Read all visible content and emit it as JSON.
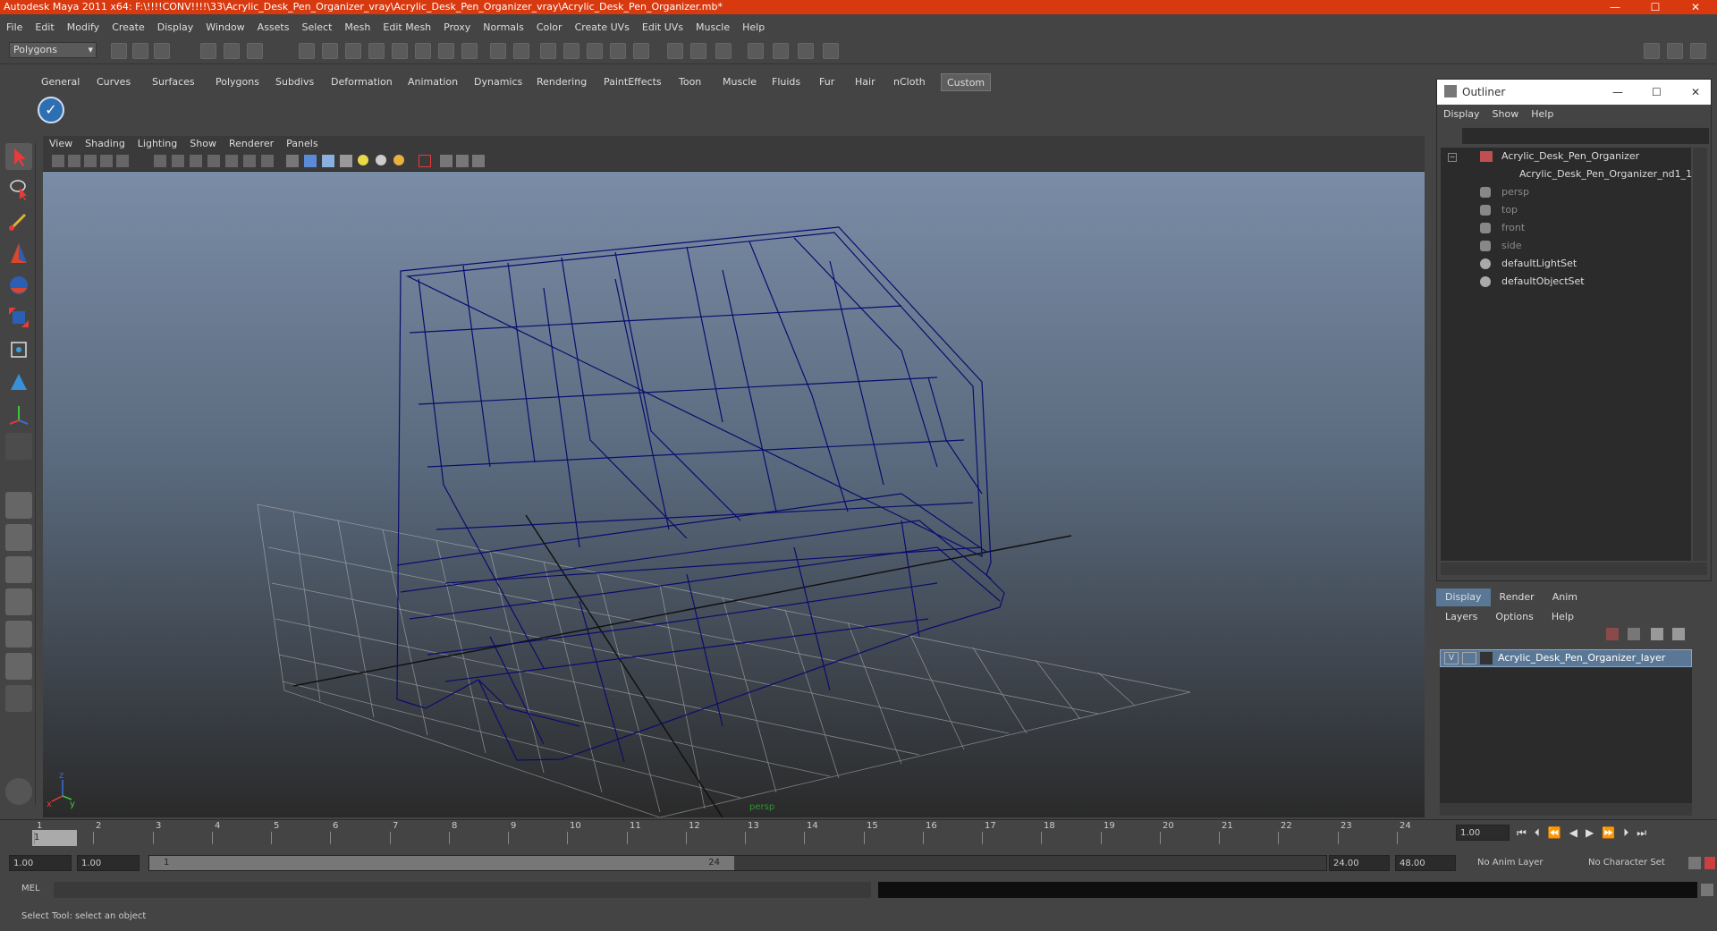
{
  "window": {
    "title": "Autodesk Maya 2011 x64: F:\\!!!!CONV!!!!\\33\\Acrylic_Desk_Pen_Organizer_vray\\Acrylic_Desk_Pen_Organizer_vray\\Acrylic_Desk_Pen_Organizer.mb*",
    "minimize": "—",
    "maximize": "☐",
    "close": "✕"
  },
  "menubar": [
    "File",
    "Edit",
    "Modify",
    "Create",
    "Display",
    "Window",
    "Assets",
    "Select",
    "Mesh",
    "Edit Mesh",
    "Proxy",
    "Normals",
    "Color",
    "Create UVs",
    "Edit UVs",
    "Muscle",
    "Help"
  ],
  "status_line": {
    "mode": "Polygons"
  },
  "shelf": {
    "tabs": [
      "General",
      "Curves",
      "Surfaces",
      "Polygons",
      "Subdivs",
      "Deformation",
      "Animation",
      "Dynamics",
      "Rendering",
      "PaintEffects",
      "Toon",
      "Muscle",
      "Fluids",
      "Fur",
      "Hair",
      "nCloth",
      "Custom"
    ],
    "active_tab": "Custom"
  },
  "viewport": {
    "menu": [
      "View",
      "Shading",
      "Lighting",
      "Show",
      "Renderer",
      "Panels"
    ],
    "camera_label": "persp",
    "axis": {
      "x": "x",
      "y": "y",
      "z": "z"
    }
  },
  "outliner": {
    "title": "Outliner",
    "menu": [
      "Display",
      "Show",
      "Help"
    ],
    "items": [
      {
        "label": "Acrylic_Desk_Pen_Organizer",
        "dim": false
      },
      {
        "label": "Acrylic_Desk_Pen_Organizer_nd1_1",
        "dim": false
      },
      {
        "label": "persp",
        "dim": true
      },
      {
        "label": "top",
        "dim": true
      },
      {
        "label": "front",
        "dim": true
      },
      {
        "label": "side",
        "dim": true
      },
      {
        "label": "defaultLightSet",
        "dim": false
      },
      {
        "label": "defaultObjectSet",
        "dim": false
      }
    ]
  },
  "layer_editor": {
    "tabs": [
      "Display",
      "Render",
      "Anim"
    ],
    "active_tab": "Display",
    "menu": [
      "Layers",
      "Options",
      "Help"
    ],
    "layer": {
      "visible": "V",
      "name": "Acrylic_Desk_Pen_Organizer_layer"
    },
    "layer_color": "#5a7896"
  },
  "timeline": {
    "ticks": [
      "1",
      "2",
      "3",
      "4",
      "5",
      "6",
      "7",
      "8",
      "9",
      "10",
      "11",
      "12",
      "13",
      "14",
      "15",
      "16",
      "17",
      "18",
      "19",
      "20",
      "21",
      "22",
      "23",
      "24"
    ],
    "current_frame": "1",
    "current_time_field": "1.00"
  },
  "range": {
    "start": "1.00",
    "playback_start": "1.00",
    "slider_start": "1",
    "slider_end": "24",
    "playback_end": "24.00",
    "end": "48.00",
    "anim_layer": "No Anim Layer",
    "character_set": "No Character Set"
  },
  "command_line": {
    "label": "MEL"
  },
  "help_line": "Select Tool: select an object",
  "colors": {
    "title_bar": "#d8390f",
    "wireframe": "#0b0b6e",
    "grid": "#c8c8c8"
  }
}
